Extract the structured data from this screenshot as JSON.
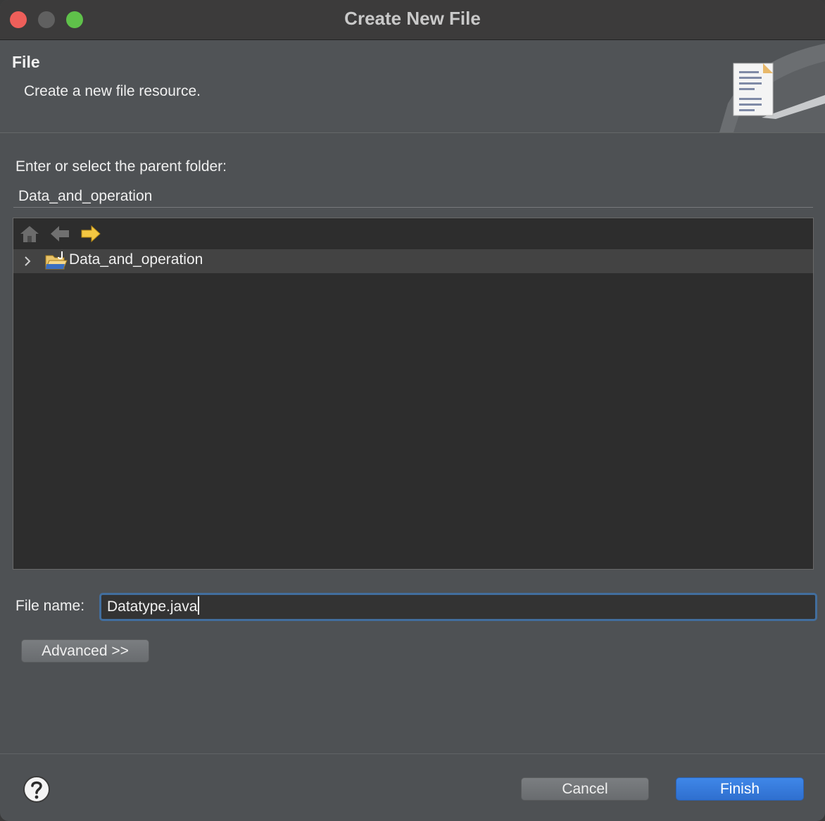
{
  "window": {
    "title": "Create New File"
  },
  "banner": {
    "title": "File",
    "subtitle": "Create a new file resource."
  },
  "parent_folder": {
    "label": "Enter or select the parent folder:",
    "value": "Data_and_operation"
  },
  "tree": {
    "toolbar": [
      "home-icon",
      "back-arrow-icon",
      "forward-arrow-icon"
    ],
    "items": [
      {
        "label": "Data_and_operation",
        "icon": "project-folder-icon",
        "expanded": false
      }
    ]
  },
  "file_name": {
    "label": "File name:",
    "value": "Datatype.java"
  },
  "buttons": {
    "advanced": "Advanced >>",
    "cancel": "Cancel",
    "finish": "Finish"
  },
  "colors": {
    "accent": "#3a7de0",
    "focus_ring": "#426e9e",
    "forward_arrow": "#f5c842"
  }
}
